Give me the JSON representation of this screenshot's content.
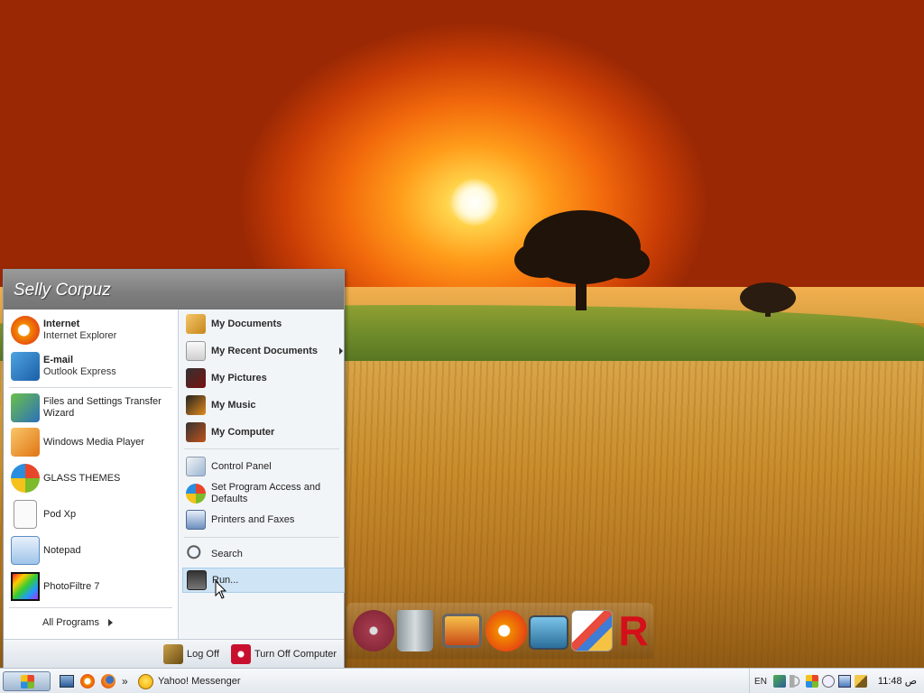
{
  "start_menu": {
    "user_name": "Selly Corpuz",
    "pinned": [
      {
        "title": "Internet",
        "subtitle": "Internet Explorer",
        "icon": "internet-explorer-icon"
      },
      {
        "title": "E-mail",
        "subtitle": "Outlook Express",
        "icon": "outlook-express-icon"
      }
    ],
    "recent": [
      {
        "label": "Files and Settings Transfer Wizard",
        "icon": "transfer-wizard-icon"
      },
      {
        "label": "Windows Media Player",
        "icon": "media-player-icon"
      },
      {
        "label": "GLASS THEMES",
        "icon": "windows-orb-icon"
      },
      {
        "label": "Pod Xp",
        "icon": "blank-document-icon"
      },
      {
        "label": "Notepad",
        "icon": "notepad-icon"
      },
      {
        "label": "PhotoFiltre 7",
        "icon": "photofiltre-icon"
      }
    ],
    "all_programs": "All Programs",
    "right": {
      "my_documents": "My Documents",
      "my_recent_documents": "My Recent Documents",
      "my_pictures": "My Pictures",
      "my_music": "My Music",
      "my_computer": "My Computer",
      "control_panel": "Control Panel",
      "set_program_access": "Set Program Access and Defaults",
      "printers_faxes": "Printers and Faxes",
      "search": "Search",
      "run": "Run..."
    },
    "log_off": "Log Off",
    "turn_off": "Turn Off Computer"
  },
  "taskbar": {
    "overflow": "»",
    "yahoo": "Yahoo! Messenger",
    "language": "EN",
    "clock": "11:48 ص"
  },
  "colors": {
    "accent": "#cfe4f5",
    "header": "#7d7d7d",
    "close_red": "#c8102e"
  }
}
